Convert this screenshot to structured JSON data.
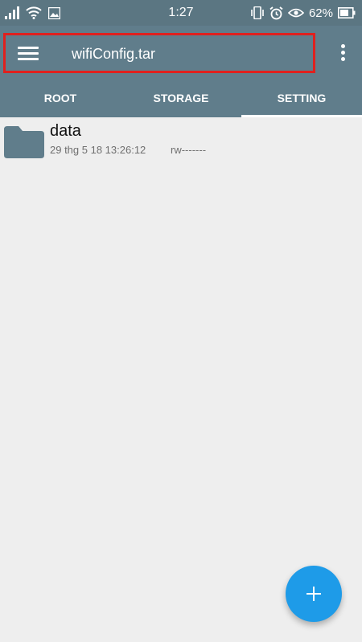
{
  "status_bar": {
    "time": "1:27",
    "battery_percent": "62%",
    "icons_left": [
      "signal-icon",
      "wifi-icon",
      "image-icon"
    ],
    "icons_right": [
      "vibrate-icon",
      "alarm-icon",
      "eye-icon",
      "battery-icon"
    ]
  },
  "app_bar": {
    "title": "wifiConfig.tar",
    "menu_icon": "hamburger-menu-icon",
    "overflow_icon": "more-vertical-icon",
    "highlight_color": "#e0201e"
  },
  "tabs": [
    {
      "label": "ROOT",
      "active": false
    },
    {
      "label": "STORAGE",
      "active": false
    },
    {
      "label": "SETTING",
      "active": true
    }
  ],
  "files": [
    {
      "name": "data",
      "date": "29 thg 5 18 13:26:12",
      "permissions": "rw-------",
      "icon": "folder-icon"
    }
  ],
  "fab": {
    "icon": "plus-icon",
    "color": "#1e9be8"
  },
  "colors": {
    "primary": "#607d8b",
    "status_bar": "#5b7682",
    "background": "#eeeeee",
    "folder": "#607d8b"
  }
}
